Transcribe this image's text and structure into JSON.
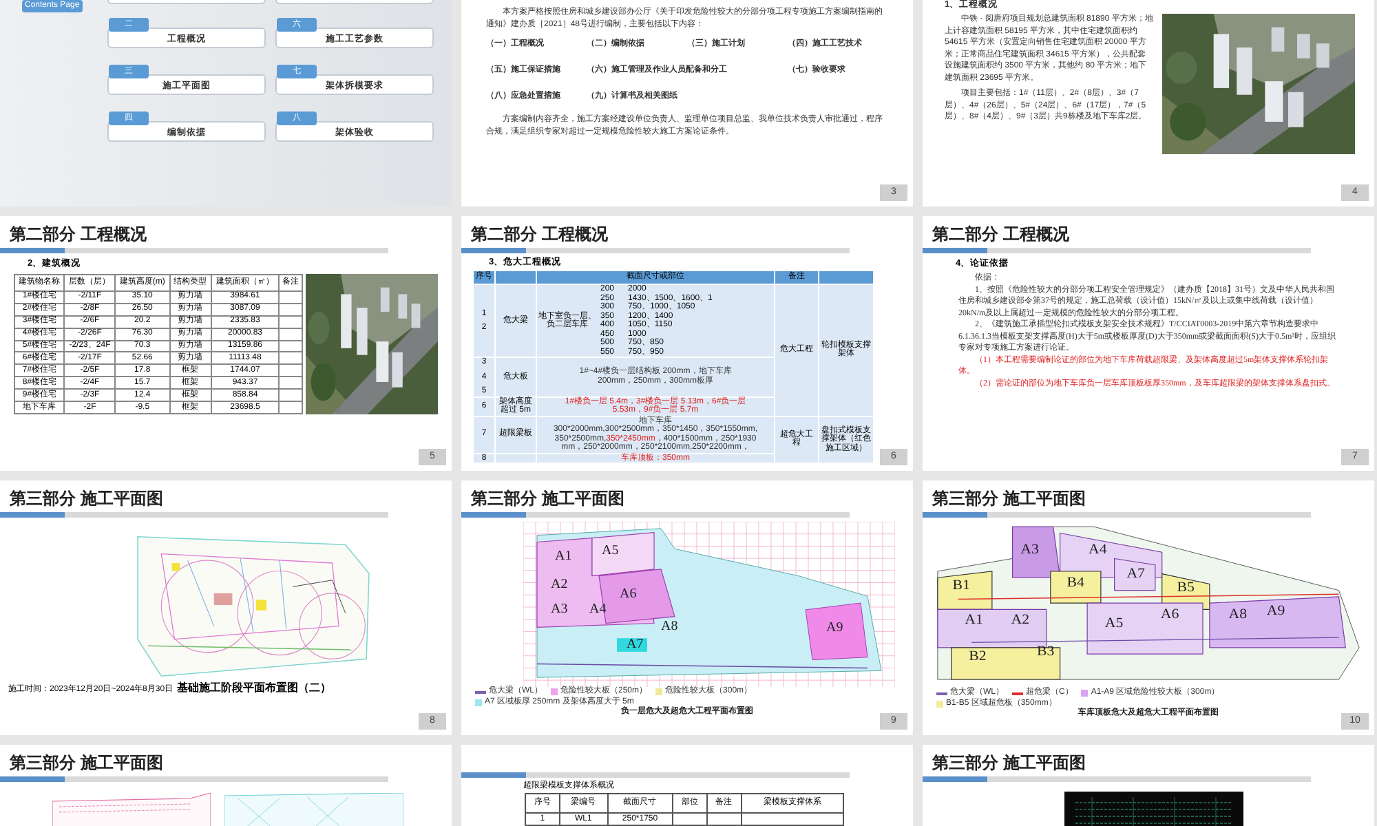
{
  "slides": [
    {
      "kind": "contents",
      "tag": "Contents Page",
      "items": [
        {
          "numeral": "二",
          "label": "工程概况"
        },
        {
          "numeral": "六",
          "label": "施工工艺参数"
        },
        {
          "numeral": "三",
          "label": "施工平面图"
        },
        {
          "numeral": "七",
          "label": "架体拆模要求"
        },
        {
          "numeral": "四",
          "label": "编制依据"
        },
        {
          "numeral": "八",
          "label": "架体验收"
        }
      ]
    },
    {
      "kind": "outline",
      "number": "3",
      "intro": "本方案严格按照住房和城乡建设部办公厅《关于印发危险性较大的分部分项工程专项施工方案编制指南的通知》建办质［2021］48号进行编制，主要包括以下内容：",
      "items": [
        "（一）工程概况",
        "（二）编制依据",
        "（三）施工计划",
        "（四）施工工艺技术",
        "（五）施工保证措施",
        "（六）施工管理及作业人员配备和分工",
        "（七）验收要求",
        "（八）应急处置措施",
        "（九）计算书及相关图纸"
      ],
      "closing": "方案编制内容齐全，施工方案经建设单位负责人、监理单位项目总监、我单位技术负责人审批通过，程序合规，满足组织专家对超过一定规模危险性较大施工方案论证条件。"
    },
    {
      "kind": "overview",
      "number": "4",
      "heading": "1、工程概况",
      "paragraphs": [
        "中铁 · 阅唐府项目规划总建筑面积 81890 平方米；地上计容建筑面积 58195 平方米，其中住宅建筑面积约 54615 平方米（安置定向销售住宅建筑面积 20000 平方米；正常商品住宅建筑面积 34615 平方米），公共配套设施建筑面积约 3500 平方米，其他约 80 平方米；地下建筑面积 23695 平方米。",
        "项目主要包括：1#（11层）、2#（8层）、3#（7层）、4#（26层）、5#（24层）、6#（17层），7#（5层）、8#（4层）、9#（3层）共9栋楼及地下车库2层。"
      ]
    },
    {
      "kind": "building_table",
      "number": "5",
      "title": "第二部分  工程概况",
      "heading": "2、建筑概况",
      "columns": [
        "建筑物名称",
        "层数（层）",
        "建筑高度(m)",
        "结构类型",
        "建筑面积（㎡）",
        "备注"
      ],
      "rows": [
        [
          "1#楼住宅",
          "-2/11F",
          "35.10",
          "剪力墙",
          "3984.61"
        ],
        [
          "2#楼住宅",
          "-2/8F",
          "26.50",
          "剪力墙",
          "3087.09"
        ],
        [
          "3#楼住宅",
          "-2/6F",
          "20.2",
          "剪力墙",
          "2335.83"
        ],
        [
          "4#楼住宅",
          "-2/26F",
          "76.30",
          "剪力墙",
          "20000.83"
        ],
        [
          "5#楼住宅",
          "-2/23、24F",
          "70.3",
          "剪力墙",
          "13159.86"
        ],
        [
          "6#楼住宅",
          "-2/17F",
          "52.66",
          "剪力墙",
          "11113.48"
        ],
        [
          "7#楼住宅",
          "-2/5F",
          "17.8",
          "框架",
          "1744.07"
        ],
        [
          "8#楼住宅",
          "-2/4F",
          "15.7",
          "框架",
          "943.37"
        ],
        [
          "9#楼住宅",
          "-2/3F",
          "12.4",
          "框架",
          "858.84"
        ],
        [
          "地下车库",
          "-2F",
          "-9.5",
          "框架",
          "23698.5"
        ]
      ]
    },
    {
      "kind": "hazard_table",
      "number": "6",
      "title": "第二部分  工程概况",
      "heading": "3、危大工程概况",
      "columns": [
        "序号",
        "截面尺寸或部位",
        "备注"
      ],
      "sections": [
        {
          "note": "危大工程",
          "system": "轮扣模板支撑架体",
          "groups": [
            {
              "numbers": [
                "1",
                "2"
              ],
              "name": "危大梁",
              "kind": "sizes",
              "part": "地下室负一层、负二层车库",
              "lines": [
                [
                  "200",
                  "2000"
                ],
                [
                  "250",
                  "1430、1500、1600、1"
                ],
                [
                  "300",
                  "750、1000、1050"
                ],
                [
                  "350",
                  "1200、1400"
                ],
                [
                  "400",
                  "1050、1150"
                ],
                [
                  "450",
                  "1000"
                ],
                [
                  "500",
                  "750、850"
                ],
                [
                  "550",
                  "750、950"
                ]
              ]
            },
            {
              "numbers": [
                "3",
                "4",
                "5"
              ],
              "name": "危大板",
              "kind": "text",
              "lines": [
                [
                  {
                    "text": "1#~4#楼负一层结构板 200mm，地下车库",
                    "red": false
                  }
                ],
                [
                  {
                    "text": "200mm，250mm，300mm板厚",
                    "red": false
                  }
                ]
              ]
            },
            {
              "numbers": [
                "6"
              ],
              "name": "架体高度超过 5m",
              "kind": "text",
              "lines": [
                [
                  {
                    "text": "1#楼负一层 5.4m，3#楼负一层 5.13m，6#负一层",
                    "red": true
                  }
                ],
                [
                  {
                    "text": "5.53m，9#负一层 5.7m",
                    "red": true
                  }
                ]
              ]
            }
          ]
        },
        {
          "note": "超危大工程",
          "system": "盘扣式模板支撑架体（红色施工区域）",
          "groups": [
            {
              "numbers": [
                "7"
              ],
              "name": "超限梁板",
              "kind": "text",
              "lines": [
                [
                  {
                    "text": "地下车库",
                    "red": false
                  }
                ],
                [
                  {
                    "text": "300*2000mm,300*2500mm，350*1450，350*1550mm,",
                    "red": false
                  }
                ],
                [
                  {
                    "text": "350*2500mm,",
                    "red": false
                  },
                  {
                    "text": "350*2450mm",
                    "red": true
                  },
                  {
                    "text": "，400*1500mm，250*1930",
                    "red": false
                  }
                ],
                [
                  {
                    "text": "mm，250*2000mm，250*2100mm,250*2200mm，",
                    "red": false
                  }
                ]
              ]
            },
            {
              "numbers": [
                "8"
              ],
              "kind": "text",
              "lines": [
                [
                  {
                    "text": "车库顶板：350mm",
                    "red": true
                  }
                ]
              ]
            }
          ]
        }
      ]
    },
    {
      "kind": "basis",
      "number": "7",
      "title": "第二部分  工程概况",
      "heading": "4、论证依据",
      "paragraphs": [
        {
          "text": "依据：",
          "red": false
        },
        {
          "text": "1、按照《危险性较大的分部分项工程安全管理规定》（建办质【2018】31号）文及中华人民共和国住房和城乡建设部令第37号的规定，施工总荷载（设计值）15kN/㎡及以上或集中线荷载（设计值）20kN/m及以上属超过一定规模的危险性较大的分部分项工程。",
          "red": false
        },
        {
          "text": "2、《建筑施工承插型轮扣式模板支架安全技术规程》T/CCIAT0003-2019中第六章节构造要求中6.1.36.1.3当模板支架支撑高度(H)大于5m或楼板厚度(D)大于350mm或梁截面面积(S)大于0.5m²时，应组织专家对专项施工方案进行论证。",
          "red": false
        },
        {
          "text": "（1）本工程需要编制论证的部位为地下车库荷载超限梁、及架体高度超过5m架体支撑体系轮扣架体。",
          "red": true
        },
        {
          "text": "（2）需论证的部位为地下车库负一层车库顶板板厚350mm，及车库超限梁的架体支撑体系盘扣式。",
          "red": true
        }
      ]
    },
    {
      "kind": "site_plan",
      "number": "8",
      "title": "第三部分 施工平面图",
      "note": "施工时间：2023年12月20日~2024年8月30日",
      "caption": "基础施工阶段平面布置图（二）"
    },
    {
      "kind": "floor_plan_basement",
      "number": "9",
      "title": "第三部分 施工平面图",
      "zones": [
        "A1",
        "A5",
        "A2",
        "A6",
        "A3",
        "A4",
        "A8",
        "A7",
        "A9"
      ],
      "legend": [
        {
          "kind": "line",
          "color": "#7a5fb0",
          "text": "危大梁（WL）"
        },
        {
          "kind": "swatch",
          "color": "#f3a3ee",
          "text": "危险性较大板（250m）"
        },
        {
          "kind": "swatch",
          "color": "#f2e79a",
          "text": "危险性较大板（300m）"
        },
        {
          "kind": "swatch",
          "color": "#9ee6f0",
          "text": "A7 区域板厚 250mm 及架体高度大于 5m"
        }
      ],
      "caption": "负一层危大及超危大工程平面布置图"
    },
    {
      "kind": "floor_plan_roof",
      "number": "10",
      "title": "第三部分 施工平面图",
      "zones": [
        "A3",
        "A4",
        "B1",
        "B4",
        "A7",
        "B5",
        "A1",
        "A2",
        "A5",
        "A6",
        "A8",
        "A9",
        "B2",
        "B3"
      ],
      "legend": [
        {
          "kind": "line",
          "color": "#7a5fb0",
          "text": "危大梁（WL）"
        },
        {
          "kind": "line",
          "color": "#e0302a",
          "text": "超危梁（C）"
        },
        {
          "kind": "swatch",
          "color": "#d8a3f0",
          "text": "A1-A9 区域危险性较大板（300m）"
        },
        {
          "kind": "swatch",
          "color": "#f0ec9a",
          "text": "B1-B5 区域超危板（350mm）"
        }
      ],
      "caption": "车库顶板危大及超危大工程平面布置图"
    },
    {
      "kind": "plans_partial",
      "title": "第三部分 施工平面图"
    },
    {
      "kind": "beam_table",
      "heading": "超限梁模板支撑体系概况",
      "columns": [
        "序号",
        "梁编号",
        "截面尺寸",
        "部位",
        "备注",
        "梁模板支撑体系"
      ],
      "row": [
        "1",
        "WL1",
        "250*1750"
      ]
    },
    {
      "kind": "cad_partial",
      "title": "第三部分 施工平面图"
    }
  ]
}
